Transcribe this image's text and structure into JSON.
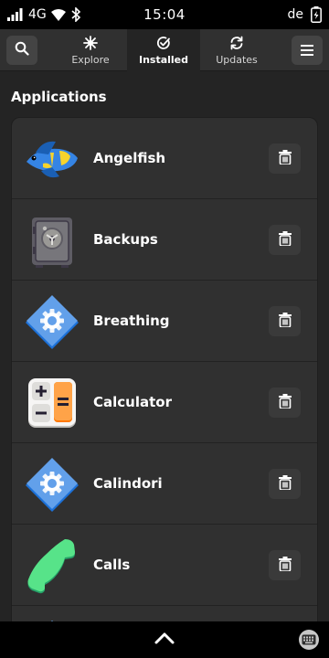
{
  "status_bar": {
    "network": "4G",
    "time": "15:04",
    "language": "de",
    "icons": [
      "signal-icon",
      "wifi-icon",
      "bluetooth-icon",
      "battery-charging-icon"
    ]
  },
  "header": {
    "search_icon": "search-icon",
    "menu_icon": "hamburger-menu-icon",
    "tabs": [
      {
        "label": "Explore",
        "icon": "explore-icon",
        "active": false
      },
      {
        "label": "Installed",
        "icon": "installed-check-icon",
        "active": true
      },
      {
        "label": "Updates",
        "icon": "refresh-icon",
        "active": false
      }
    ]
  },
  "main": {
    "section_title": "Applications",
    "apps": [
      {
        "name": "Angelfish",
        "icon": "angelfish-icon"
      },
      {
        "name": "Backups",
        "icon": "backups-safe-icon"
      },
      {
        "name": "Breathing",
        "icon": "breathing-icon"
      },
      {
        "name": "Calculator",
        "icon": "calculator-icon"
      },
      {
        "name": "Calindori",
        "icon": "calindori-icon"
      },
      {
        "name": "Calls",
        "icon": "calls-phone-icon"
      }
    ],
    "delete_icon": "trash-icon"
  },
  "bottom_bar": {
    "icons": [
      "chevron-up-icon",
      "keyboard-icon"
    ]
  },
  "colors": {
    "background": "#242424",
    "surface": "#303030",
    "accent_blue": "#3584e4",
    "status_bar": "#000000"
  }
}
